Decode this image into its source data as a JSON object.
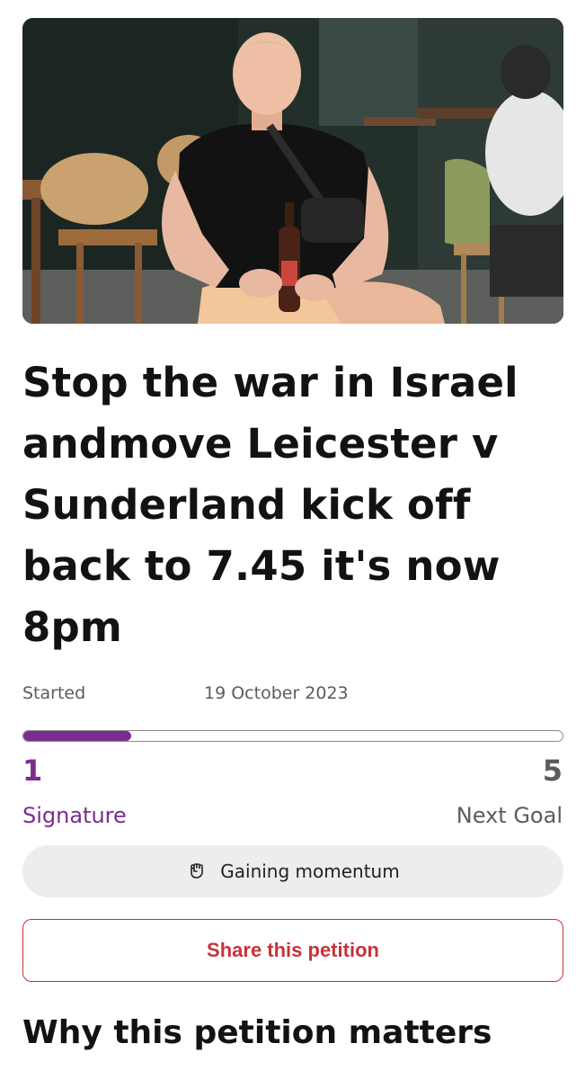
{
  "petition": {
    "title": "Stop the war in Israel andmove Leicester v Sunderland kick off back to 7.45 it's now 8pm",
    "started_label": "Started",
    "started_date": "19 October 2023"
  },
  "progress": {
    "signatures": "1",
    "signatures_label": "Signature",
    "goal": "5",
    "goal_label": "Next Goal",
    "fraction": 0.2,
    "color": "#7b2d8f"
  },
  "momentum": {
    "icon": "raised-fist-icon",
    "label": "Gaining momentum"
  },
  "share": {
    "label": "Share this petition",
    "color": "#c8323a"
  },
  "section": {
    "heading": "Why this petition matters"
  }
}
